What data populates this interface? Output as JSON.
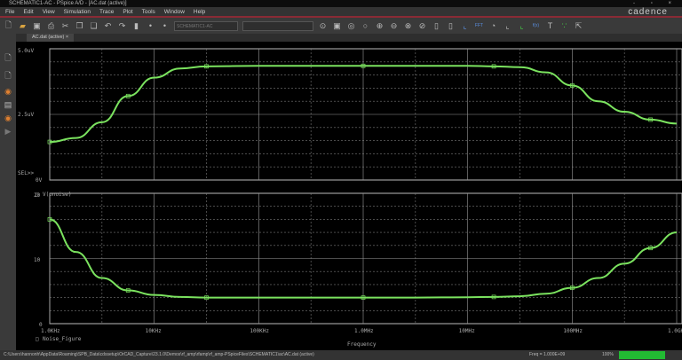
{
  "window": {
    "title": "SCHEMATIC1-AC - PSpice A/D - [AC.dat (active)]",
    "controls": "- ▫ ×"
  },
  "menu": [
    "File",
    "Edit",
    "View",
    "Simulation",
    "Trace",
    "Plot",
    "Tools",
    "Window",
    "Help"
  ],
  "brand": "cadence",
  "toolbar": {
    "profile": "SCHEMATIC1-AC"
  },
  "tab": {
    "label": "AC.dat (active)"
  },
  "status": {
    "path": "C:\\Users\\hannonh\\AppData\\Roaming\\SPB_Data\\cdssetup\\OrCAD_Capture\\23.1.0\\Demos\\rf_amp\\rfamp\\rf_amp-PSpiceFiles\\SCHEMATIC1\\ac\\AC.dat (active)",
    "freq": "Freq = 1.000E+09",
    "zoom": "100%",
    "progress": 1.0
  },
  "chart_data": [
    {
      "type": "line",
      "title": "",
      "xlabel": "Frequency",
      "ylabel": "",
      "xscale": "log",
      "xlim": [
        1000,
        1000000000
      ],
      "xticks": [
        "1.0KHz",
        "10KHz",
        "100KHz",
        "1.0MHz",
        "10MHz",
        "100MHz",
        "1.0GHz"
      ],
      "yticks": [
        "0V",
        "2.5uV",
        "5.0uV"
      ],
      "ylim": [
        0,
        5
      ],
      "sel_marker": "SEL>>",
      "series": [
        {
          "name": "V(onoise)",
          "color": "#7be35f",
          "log10_x": [
            3,
            3.25,
            3.5,
            3.75,
            4,
            4.25,
            4.5,
            5,
            5.5,
            6,
            6.5,
            7,
            7.25,
            7.5,
            7.75,
            8,
            8.25,
            8.5,
            8.75,
            9
          ],
          "y_uV": [
            1.45,
            1.6,
            2.2,
            3.2,
            3.9,
            4.25,
            4.33,
            4.35,
            4.35,
            4.35,
            4.35,
            4.35,
            4.33,
            4.3,
            4.1,
            3.6,
            3.0,
            2.6,
            2.3,
            2.15
          ]
        }
      ]
    },
    {
      "type": "line",
      "title": "",
      "xlabel": "Frequency",
      "ylabel": "",
      "xscale": "log",
      "xlim": [
        1000,
        1000000000
      ],
      "yticks": [
        "0",
        "10",
        "20"
      ],
      "ylim": [
        0,
        20
      ],
      "series": [
        {
          "name": "Noise_Figure",
          "color": "#7be35f",
          "log10_x": [
            3,
            3.25,
            3.5,
            3.75,
            4,
            4.25,
            4.5,
            5,
            5.5,
            6,
            6.5,
            7,
            7.25,
            7.5,
            7.75,
            8,
            8.25,
            8.5,
            8.75,
            9
          ],
          "y": [
            16,
            11,
            7,
            5.1,
            4.4,
            4.1,
            4.0,
            4.0,
            4.0,
            4.0,
            4.0,
            4.05,
            4.1,
            4.2,
            4.6,
            5.5,
            7.0,
            9.2,
            11.6,
            14
          ]
        }
      ]
    }
  ]
}
